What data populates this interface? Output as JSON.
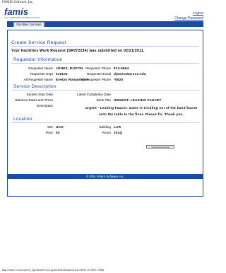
{
  "window": {
    "title": "FAMIS Software, Inc."
  },
  "header": {
    "logo_text": "famis",
    "logo_subtext": "FACILITY MANAGEMENT INFORMATION SYSTEMS",
    "logout_label": "Logout",
    "change_password_label": "Change Password"
  },
  "nav": {
    "tabs": [
      {
        "label": "Facilities Services"
      }
    ]
  },
  "page": {
    "title": "Create Service Request",
    "submitted_text": "Your Facilities Work Request (SR072234) was submitted on 02/21/2011."
  },
  "requestor": {
    "heading": "Requestor Information",
    "name_label": "Requester Name",
    "name_value": "JONES, DUSTIN",
    "phone_label": "Requestor Phone",
    "phone_value": "974-5564",
    "dept_label": "Requester Dept",
    "dept_value": "010102",
    "email_label": "Requestor Email",
    "email_value": "djones45@uco.edu",
    "alt_name_label": "Alt Requester Name",
    "alt_name_value": "Evelyn RomanNose",
    "alt_phone_label": "Alt Requester Phone",
    "alt_phone_value": "*5520"
  },
  "service": {
    "heading": "Service Description",
    "earliest_label": "Earliest Start Date",
    "earliest_value": "",
    "latest_label": "Latest Completion Date",
    "latest_value": "",
    "blackout_label": "Blackout Dates and Times",
    "blackout_value": "",
    "worktitle_label": "Work Title",
    "worktitle_value": "URGENT: LEAKING FAUCET",
    "description_label": "Description",
    "description_value": "Urgent - Leaking Faucet: water is trickling out of the hand faucet onto the table to the floor. Please fix. Thank you."
  },
  "location": {
    "heading": "Location",
    "site_label": "Site",
    "site_value": "UCO",
    "building_label": "Building",
    "building_value": "LAR",
    "floor_label": "Floor",
    "floor_value": "02",
    "room_label": "Room",
    "room_value": "201Q"
  },
  "actions": {
    "button_label": "Create New Request"
  },
  "footer": {
    "copyright": "© 2004 FAMIS Software, Inc."
  },
  "status_bar": {
    "url": "http://emys-srv.local/fsv_fps/SelfService.generateContainer/(2/21/2011 10:36:51 AM)"
  },
  "colors": {
    "brand_blue": "#1d4aa4",
    "logo_blue": "#1d3f94",
    "link_blue": "#1a3fb0"
  },
  "icons": {
    "logo": "famis-logo"
  }
}
